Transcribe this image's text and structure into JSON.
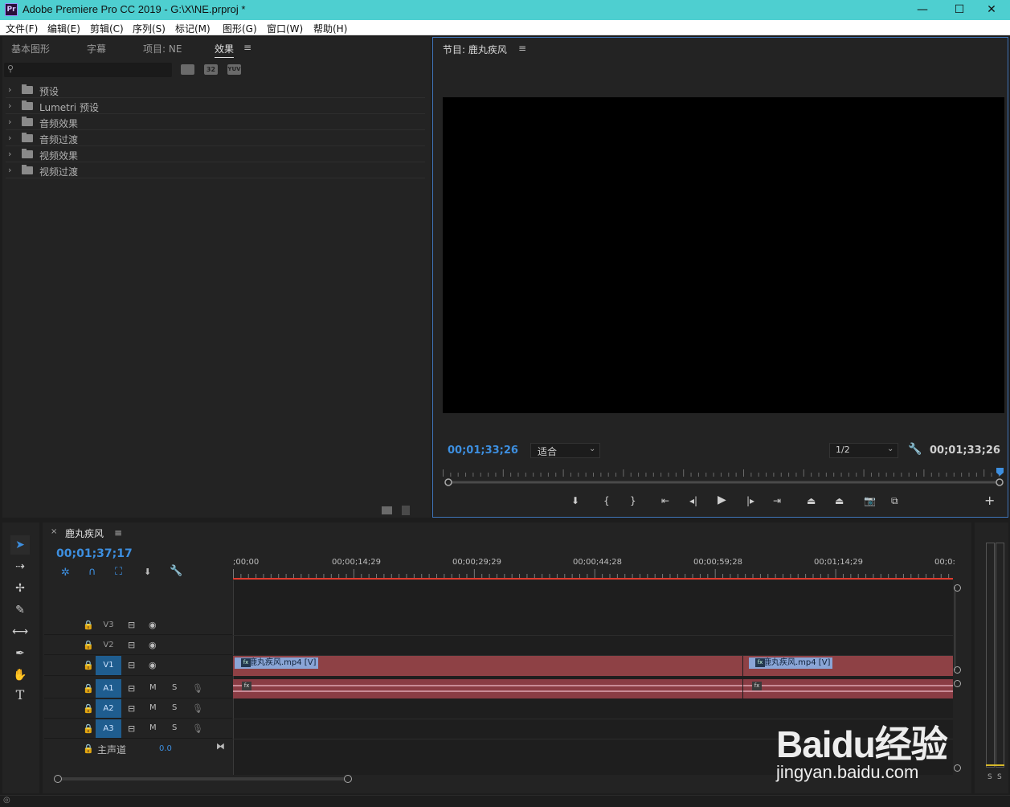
{
  "window": {
    "app_logo": "Pr",
    "title": "Adobe Premiere Pro CC 2019 - G:\\X\\NE.prproj *",
    "min": "—",
    "max": "☐",
    "close": "✕"
  },
  "menu": [
    "文件(F)",
    "编辑(E)",
    "剪辑(C)",
    "序列(S)",
    "标记(M)",
    "图形(G)",
    "窗口(W)",
    "帮助(H)"
  ],
  "left_panel": {
    "tabs": [
      "基本图形",
      "字幕",
      "项目: NE",
      "效果"
    ],
    "active_tab": "效果",
    "search_placeholder": "",
    "filter_icons": [
      "32",
      "YUV"
    ],
    "effects": [
      {
        "label": "预设",
        "icon": "preset-folder-icon"
      },
      {
        "label": "Lumetri 预设",
        "icon": "preset-folder-icon"
      },
      {
        "label": "音频效果",
        "icon": "folder-icon"
      },
      {
        "label": "音频过渡",
        "icon": "folder-icon"
      },
      {
        "label": "视频效果",
        "icon": "folder-icon"
      },
      {
        "label": "视频过渡",
        "icon": "folder-icon"
      }
    ]
  },
  "program_monitor": {
    "title": "节目: 鹿丸疾风",
    "timecode_current": "00;01;33;26",
    "zoom": "适合",
    "resolution": "1/2",
    "timecode_duration": "00;01;33;26"
  },
  "timeline": {
    "sequence_name": "鹿丸疾风",
    "timecode": "00;01;37;17",
    "ruler_labels": [
      ";00;00",
      "00;00;14;29",
      "00;00;29;29",
      "00;00;44;28",
      "00;00;59;28",
      "00;01;14;29",
      "00;0:"
    ],
    "tracks": [
      {
        "id": "V3",
        "active": false,
        "type": "video"
      },
      {
        "id": "V2",
        "active": false,
        "type": "video"
      },
      {
        "id": "V1",
        "active": true,
        "type": "video"
      },
      {
        "id": "A1",
        "active": true,
        "type": "audio"
      },
      {
        "id": "A2",
        "active": true,
        "type": "audio"
      },
      {
        "id": "A3",
        "active": true,
        "type": "audio"
      }
    ],
    "track_toggles": {
      "mute": "M",
      "solo": "S"
    },
    "master": {
      "label": "主声道",
      "value": "0.0"
    },
    "clips": [
      {
        "label": "鹿丸疾风.mp4 [V]"
      },
      {
        "label": "鹿丸疾风.mp4 [V]"
      }
    ],
    "fx_badge": "fx"
  },
  "audio_meter": {
    "solo_labels": [
      "S",
      "S"
    ]
  },
  "watermark": {
    "logo": "Baidu经验",
    "url": "jingyan.baidu.com"
  },
  "colors": {
    "accent": "#3d8fe0",
    "titlebar": "#4ecfd0",
    "clip": "#8e4145",
    "playhead": "#e03b2e"
  }
}
